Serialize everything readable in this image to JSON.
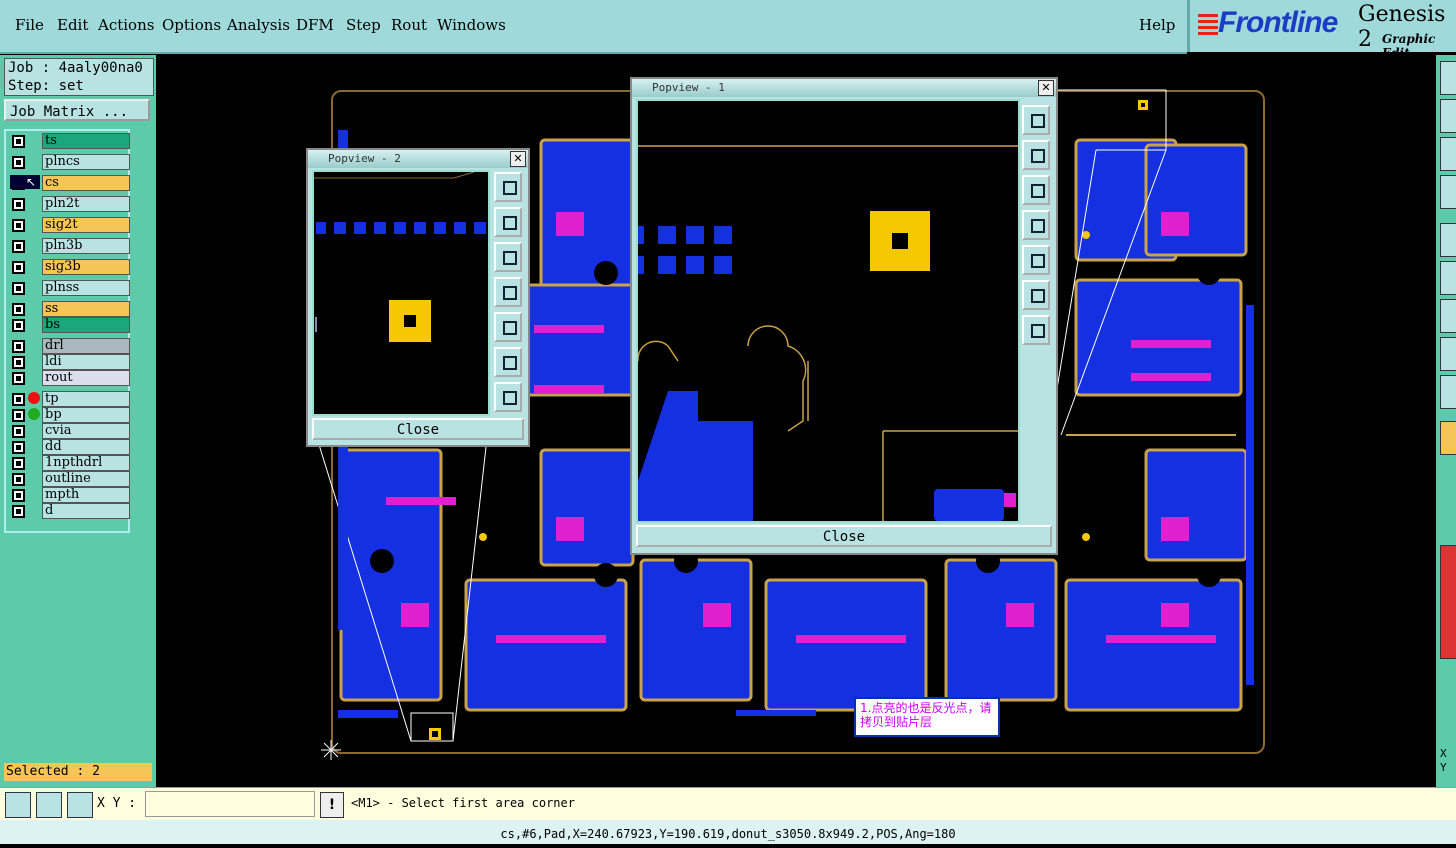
{
  "menu": [
    "File",
    "Edit",
    "Actions",
    "Options",
    "Analysis",
    "DFM",
    "Step",
    "Rout",
    "Windows"
  ],
  "help": "Help",
  "brand": {
    "logo": "Frontline",
    "product": "Genesis 2",
    "subtitle": "Graphic Edit"
  },
  "job": {
    "job": "Job : 4aaly00na0",
    "step": "Step: set",
    "matrix_button": "Job Matrix ..."
  },
  "layers": [
    {
      "name": "ts",
      "color": "#1aa87a"
    },
    {
      "name": "plncs",
      "color": "#b9e3e3"
    },
    {
      "name": "cs",
      "color": "#f5c655"
    },
    {
      "name": "pln2t",
      "color": "#b9e3e3"
    },
    {
      "name": "sig2t",
      "color": "#f5c655"
    },
    {
      "name": "pln3b",
      "color": "#b9e3e3"
    },
    {
      "name": "sig3b",
      "color": "#f5c655"
    },
    {
      "name": "plnss",
      "color": "#b9e3e3"
    },
    {
      "name": "ss",
      "color": "#f5c655"
    },
    {
      "name": "bs",
      "color": "#1aa87a"
    },
    {
      "name": "drl",
      "color": "#aab8c0"
    },
    {
      "name": "ldi",
      "color": "#b9e3e3"
    },
    {
      "name": "rout",
      "color": "#dde"
    },
    {
      "name": "tp",
      "color": "#b9e3e3"
    },
    {
      "name": "bp",
      "color": "#b9e3e3"
    },
    {
      "name": "cvia",
      "color": "#b9e3e3"
    },
    {
      "name": "dd",
      "color": "#b9e3e3"
    },
    {
      "name": "1npthdrl",
      "color": "#b9e3e3"
    },
    {
      "name": "outline",
      "color": "#b9e3e3"
    },
    {
      "name": "mpth",
      "color": "#b9e3e3"
    },
    {
      "name": "d",
      "color": "#b9e3e3"
    }
  ],
  "selected": "Selected : 2",
  "popup1": {
    "title": "Popview - 1",
    "close": "Close"
  },
  "popup2": {
    "title": "Popview - 2",
    "close": "Close"
  },
  "note": "1.点亮的也是反光点，请拷贝到贴片层",
  "xy_label": "X Y :",
  "warn": "!",
  "prompt": "<M1> - Select first area corner",
  "status": "cs,#6,Pad,X=240.67923,Y=190.619,donut_s3050.8x949.2,POS,Ang=180",
  "side_xy": [
    "X",
    "Y"
  ],
  "colors": {
    "bg": "#000000",
    "copper": "#1530e0",
    "pad": "#e020d0",
    "highlight": "#f5c800",
    "panel": "#5dcaa9"
  }
}
